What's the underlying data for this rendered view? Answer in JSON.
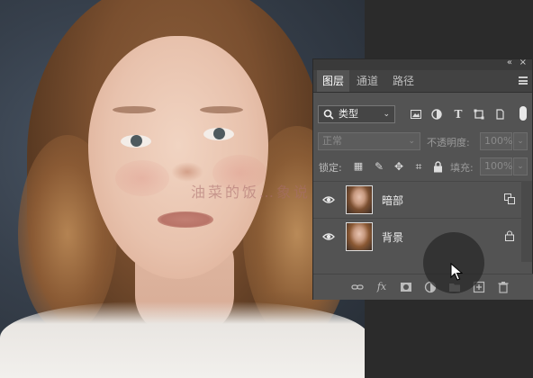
{
  "image": {
    "subject": "portrait-photo",
    "watermark": "油菜的饭…象说"
  },
  "layers_panel": {
    "header_icons": {
      "collapse": "«",
      "close": "×"
    },
    "tabs": [
      {
        "label": "图层",
        "active": true
      },
      {
        "label": "通道",
        "active": false
      },
      {
        "label": "路径",
        "active": false
      }
    ],
    "filter": {
      "label": "类型",
      "icons": [
        "image-filter-icon",
        "adjustment-filter-icon",
        "text-filter-icon",
        "shape-filter-icon",
        "smart-object-filter-icon",
        "filter-toggle-icon"
      ]
    },
    "blend_mode": "正常",
    "opacity_label": "不透明度:",
    "opacity_value": "100%",
    "lock_label": "锁定:",
    "fill_label": "填充:",
    "fill_value": "100%",
    "layers": [
      {
        "name": "暗部",
        "visible": true,
        "badge": "linked-layer-icon"
      },
      {
        "name": "背景",
        "visible": true,
        "badge": "lock-icon"
      }
    ],
    "bottom_icons": [
      "link-layers-icon",
      "fx-icon",
      "mask-icon",
      "adjustment-icon",
      "group-icon",
      "new-layer-icon",
      "delete-icon"
    ],
    "fx_text": "fx"
  },
  "colors": {
    "panel_bg": "#535353",
    "tab_bar": "#424242",
    "workspace": "#2b2b2b"
  }
}
